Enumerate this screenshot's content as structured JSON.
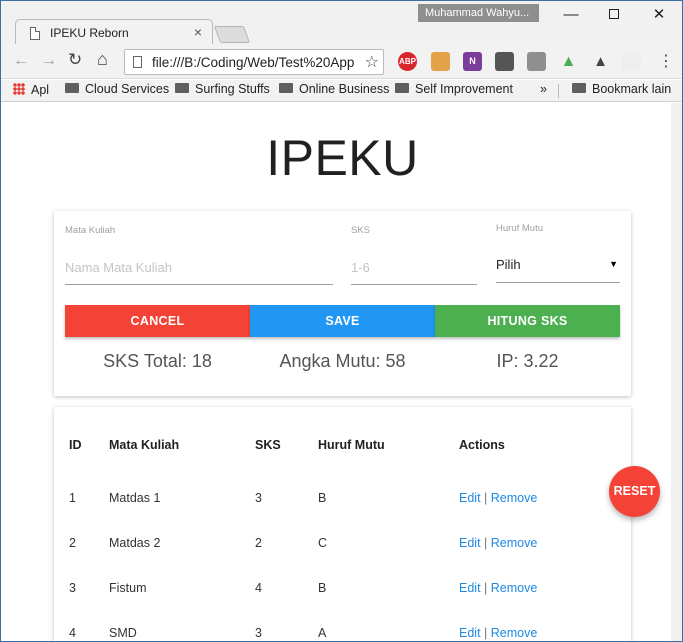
{
  "browser": {
    "tab_title": "IPEKU Reborn",
    "tab_close": "×",
    "user_name": "Muhammad Wahyu...",
    "url": "file:///B:/Coding/Web/Test%20App",
    "window_controls": {
      "minimize": "—",
      "close": "✕"
    },
    "extensions": [
      "ABP",
      "onenote-icon",
      "google-drive-icon"
    ],
    "extension_labels": {
      "abp": "ABP",
      "onenote": "N",
      "drive": "▲"
    },
    "bookmarks": {
      "apps": "Apl",
      "items": [
        "Cloud Services",
        "Surfing Stuffs",
        "Online Business",
        "Self Improvement"
      ],
      "overflow": "»",
      "other": "Bookmark lain"
    }
  },
  "app": {
    "title": "IPEKU",
    "form": {
      "mata_kuliah": {
        "label": "Mata Kuliah",
        "placeholder": "Nama Mata Kuliah",
        "value": ""
      },
      "sks": {
        "label": "SKS",
        "placeholder": "1-6",
        "value": ""
      },
      "huruf_mutu": {
        "label": "Huruf Mutu",
        "selected": "Pilih"
      }
    },
    "buttons": {
      "cancel": "Cancel",
      "save": "Save",
      "hitung": "Hitung SKS"
    },
    "stats": {
      "sks_total": "SKS Total: 18",
      "angka_mutu": "Angka Mutu: 58",
      "ip": "IP: 3.22"
    },
    "table": {
      "headers": [
        "ID",
        "Mata Kuliah",
        "SKS",
        "Huruf Mutu",
        "Actions"
      ],
      "rows": [
        {
          "id": "1",
          "mata_kuliah": "Matdas 1",
          "sks": "3",
          "huruf": "B"
        },
        {
          "id": "2",
          "mata_kuliah": "Matdas 2",
          "sks": "2",
          "huruf": "C"
        },
        {
          "id": "3",
          "mata_kuliah": "Fistum",
          "sks": "4",
          "huruf": "B"
        },
        {
          "id": "4",
          "mata_kuliah": "SMD",
          "sks": "3",
          "huruf": "A"
        }
      ],
      "edit_label": "Edit",
      "separator": "|",
      "remove_label": "Remove"
    },
    "reset_label": "RESET",
    "colors": {
      "cancel": "#f44336",
      "save": "#2196f3",
      "hitung": "#4caf50",
      "link": "#1e88e5",
      "reset": "#f44336"
    }
  }
}
